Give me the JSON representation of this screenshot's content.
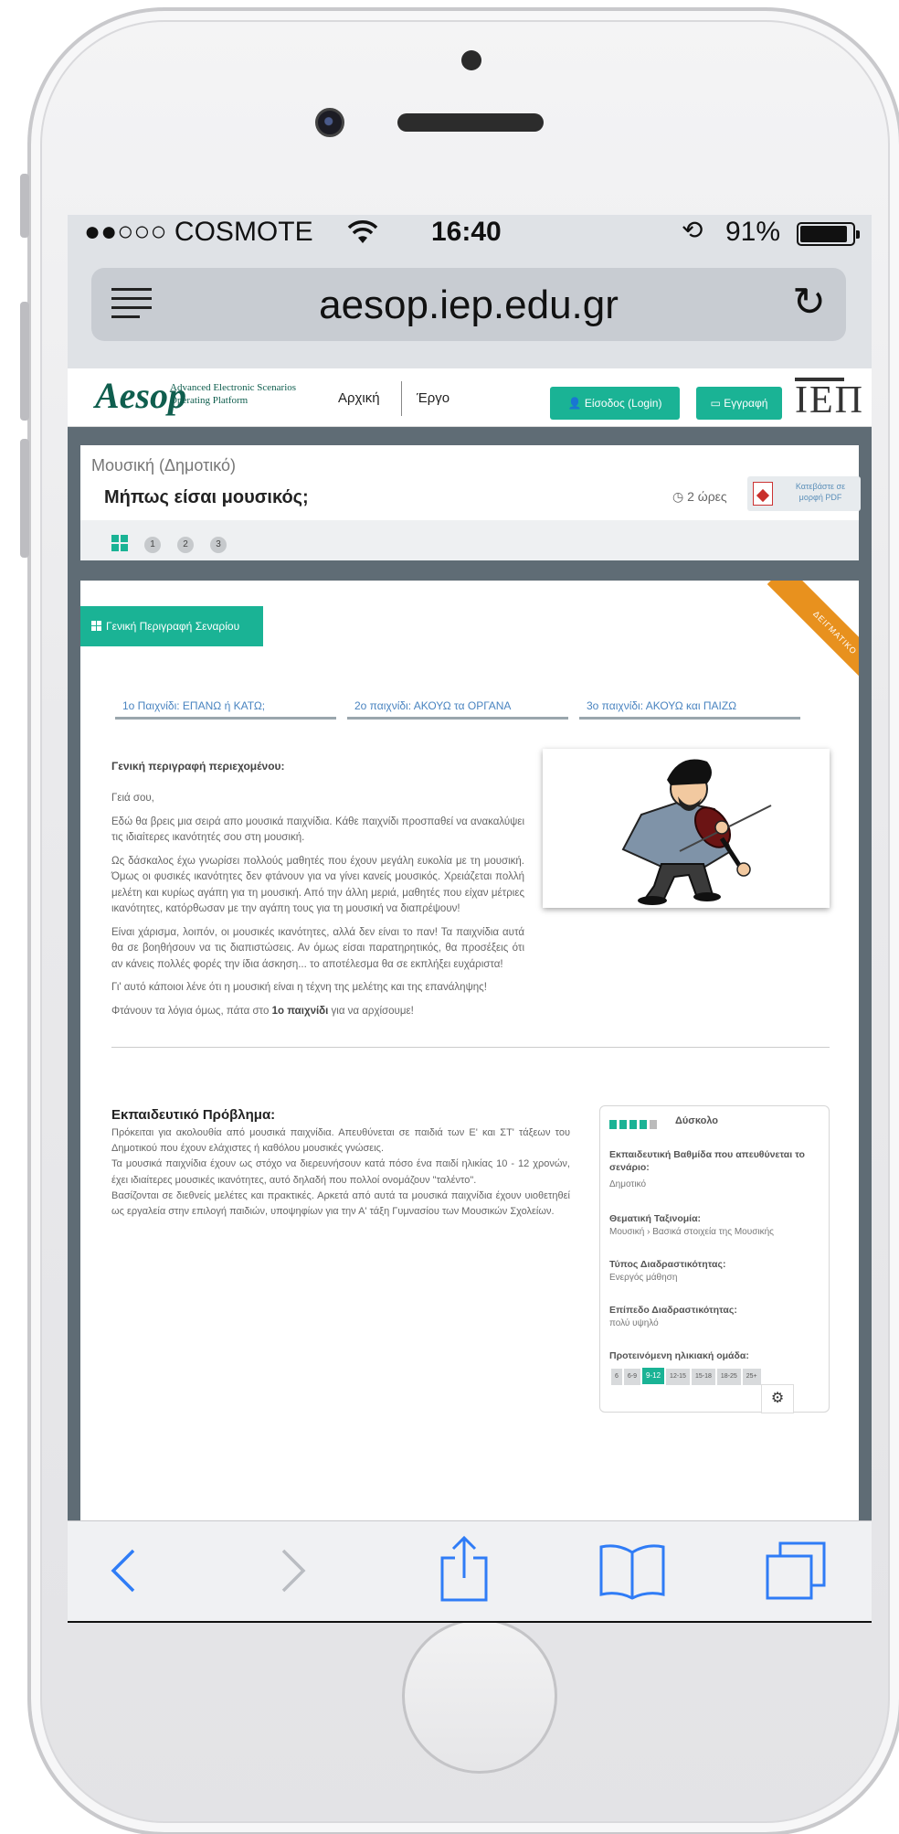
{
  "status_bar": {
    "carrier": "●●○○○ COSMOTE",
    "time": "16:40",
    "battery": "91%",
    "battery_level": 0.91
  },
  "browser": {
    "url": "aesop.iep.edu.gr"
  },
  "site_nav": {
    "logo": "Aesop",
    "logo_tagline_1": "Advanced Electronic Scenarios",
    "logo_tagline_2": "Operating Platform",
    "home": "Αρχική",
    "work": "Έργο",
    "login": "Είσοδος (Login)",
    "register": "Εγγραφή",
    "partner_logo": "ΙΕΠ"
  },
  "scenario_header": {
    "subject": "Μουσική (Δημοτικό)",
    "title": "Μήπως είσαι μουσικός;",
    "duration": "2 ώρες",
    "pdf_label": "Κατεβάστε σε μορφή PDF",
    "steps": [
      "1",
      "2",
      "3"
    ]
  },
  "content": {
    "ribbon": "ΔΕΙΓΜΑΤΙΚΟ",
    "general_tag": "Γενική Περιγραφή Σεναρίου",
    "game_tabs": [
      "1ο Παιχνίδι: ΕΠΑΝΩ ή ΚΑΤΩ;",
      "2ο παιχνίδι: ΑΚΟΥΩ τα ΟΡΓΑΝΑ",
      "3ο παιχνίδι: ΑΚΟΥΩ και ΠΑΙΖΩ"
    ],
    "heading": "Γενική περιγραφή περιεχομένου:",
    "greeting": "Γειά σου,",
    "p1": "Εδώ θα βρεις μια σειρά απο μουσικά παιχνίδια. Κάθε παιχνίδι προσπαθεί να ανακαλύψει τις ιδιαίτερες ικανότητές σου στη μουσική.",
    "p2": "Ως δάσκαλος έχω γνωρίσει πολλούς μαθητές που έχουν μεγάλη ευκολία με τη μουσική. Όμως οι φυσικές ικανότητες δεν φτάνουν για να γίνει κανείς μουσικός. Χρειάζεται πολλή μελέτη και κυρίως αγάπη για τη μουσική. Από την άλλη μεριά, μαθητές που είχαν μέτριες ικανότητες, κατόρθωσαν με την αγάπη τους για τη μουσική να διαπρέψουν!",
    "p3": "Είναι χάρισμα, λοιπόν, οι μουσικές ικανότητες, αλλά δεν είναι το παν! Τα παιχνίδια αυτά θα σε βοηθήσουν να τις διαπιστώσεις. Αν όμως είσαι παρατηρητικός, θα προσέξεις ότι αν κάνεις πολλές φορές την ίδια άσκηση... το αποτέλεσμα θα σε εκπλήξει ευχάριστα!",
    "p4": "Γι' αυτό κάποιοι λένε ότι η μουσική είναι η τέχνη της μελέτης και της επανάληψης!",
    "p5_pre": "Φτάνουν τα λόγια όμως, πάτα στο ",
    "p5_bold": "1ο παιχνίδι",
    "p5_post": " για να αρχίσουμε!"
  },
  "problem": {
    "title": "Εκπαιδευτικό Πρόβλημα:",
    "text1": "Πρόκειται για ακολουθία από μουσικά παιχνίδια. Απευθύνεται σε παιδιά των Ε' και ΣΤ' τάξεων του Δημοτικού που έχουν ελάχιστες ή καθόλου μουσικές γνώσεις.",
    "text2": "Τα μουσικά παιχνίδια έχουν ως στόχο να διερευνήσουν κατά πόσο ένα παιδί ηλικίας 10 - 12 χρονών, έχει ιδιαίτερες μουσικές ικανότητες, αυτό δηλαδή που πολλοί ονομάζουν \"ταλέντο\".",
    "text3": "Βασίζονται σε διεθνείς μελέτες και πρακτικές. Αρκετά από αυτά τα μουσικά παιχνίδια έχουν υιοθετηθεί ως εργαλεία στην επιλογή παιδιών, υποψηφίων για την Α' τάξη Γυμνασίου των Μουσικών Σχολείων."
  },
  "side_panel": {
    "difficulty": "Δύσκολο",
    "difficulty_level": 4,
    "difficulty_max": 5,
    "level_label": "Εκπαιδευτική Βαθμίδα που απευθύνεται το σενάριο:",
    "level_value": "Δημοτικό",
    "taxonomy_label": "Θεματική Ταξινομία:",
    "taxonomy_value": "Μουσική › Βασικά στοιχεία της Μουσικής",
    "interaction_type_label": "Τύπος Διαδραστικότητας:",
    "interaction_type_value": "Ενεργός μάθηση",
    "interaction_level_label": "Επίπεδο Διαδραστικότητας:",
    "interaction_level_value": "πολύ υψηλό",
    "age_label": "Προτεινόμενη ηλικιακή ομάδα:",
    "ages": [
      "6",
      "6-9",
      "9-12",
      "12-15",
      "15-18",
      "18-25",
      "25+"
    ],
    "selected_age": "9-12"
  },
  "colors": {
    "accent": "#1ab395",
    "ribbon": "#e8911e",
    "link": "#4a84c0",
    "toolbar_icon": "#2f7cf6"
  },
  "icons": {
    "menu": "menu-icon",
    "reload": "reload-icon",
    "back": "back-icon",
    "forward": "forward-icon",
    "share": "share-icon",
    "bookmarks": "bookmarks-icon",
    "tabs": "tabs-icon"
  }
}
